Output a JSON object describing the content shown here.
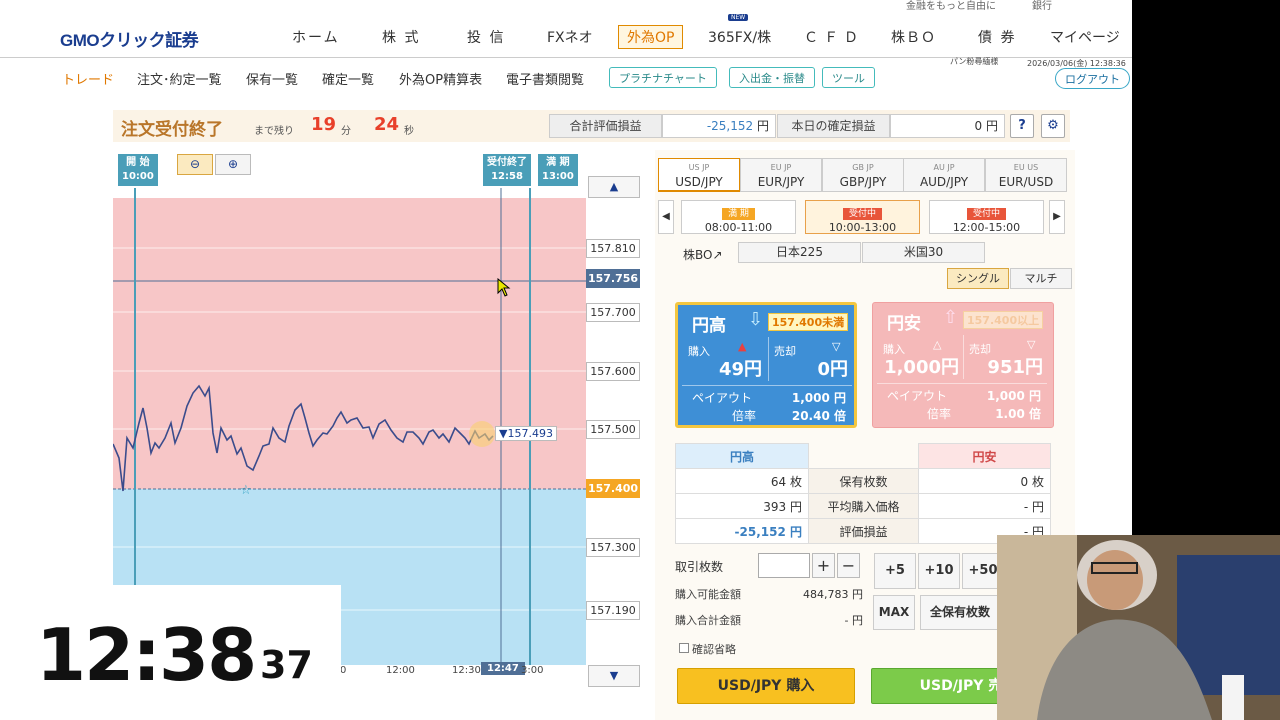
{
  "topstrip": {
    "text1": "金融をもっと自由に",
    "text2": "銀行"
  },
  "nav": {
    "logo": "GMOクリック証券",
    "items": [
      "ホーム",
      "株 式",
      "投 信",
      "FXネオ",
      "外為OP",
      "365FX/株",
      "ＣＦＤ",
      "株ＢＯ",
      "債 券",
      "マイページ"
    ],
    "new_badge": "NEW"
  },
  "subnav": {
    "items": [
      "トレード",
      "注文･約定一覧",
      "保有一覧",
      "確定一覧",
      "外為OP精算表",
      "電子書類閲覧"
    ],
    "pills": [
      "プラチナチャート",
      "入出金・振替",
      "ツール"
    ],
    "user": "パン粉尋緬様",
    "datetime": "2026/03/06(金) 12:38:36",
    "logout": "ログアウト"
  },
  "status": {
    "title": "注文受付終了",
    "remain_label": "まで残り",
    "minutes": "19",
    "min_unit": "分",
    "seconds": "24",
    "sec_unit": "秒",
    "total_label": "合計評価損益",
    "total_value": "-25,152",
    "yen": "円",
    "today_label": "本日の確定損益",
    "today_value": "0"
  },
  "chart": {
    "start_label": "開 始",
    "start_time": "10:00",
    "close_label": "受付終了",
    "close_time": "12:58",
    "expiry_label": "満 期",
    "expiry_time": "13:00",
    "price_ticks": [
      "157.810",
      "157.700",
      "157.600",
      "157.500",
      "157.300",
      "157.190"
    ],
    "current_line_price": "157.756",
    "strike": "157.400",
    "last_price": "▼157.493",
    "x_labels": [
      "0",
      "12:00",
      "12:30",
      "3:00"
    ],
    "now_label": "12:47"
  },
  "clock": {
    "hm": "12:38",
    "sec": "37"
  },
  "panel": {
    "pairs": [
      {
        "label": "USD/JPY",
        "flags": "US JP"
      },
      {
        "label": "EUR/JPY",
        "flags": "EU JP"
      },
      {
        "label": "GBP/JPY",
        "flags": "GB JP"
      },
      {
        "label": "AUD/JPY",
        "flags": "AU JP"
      },
      {
        "label": "EUR/USD",
        "flags": "EU US"
      }
    ],
    "slots": [
      {
        "badge": "満 期",
        "time": "08:00-11:00",
        "color": "#f5a623"
      },
      {
        "badge": "受付中",
        "time": "10:00-13:00",
        "color": "#e8553a"
      },
      {
        "badge": "受付中",
        "time": "12:00-15:00",
        "color": "#e8553a"
      }
    ],
    "kabubo": "株BO↗",
    "kabu_items": [
      "日本225",
      "米国30"
    ],
    "modes": [
      "シングル",
      "マルチ"
    ],
    "cards": {
      "high": {
        "title": "円高",
        "threshold": "157.400未満",
        "buy_label": "購入",
        "buy_price": "49円",
        "sell_label": "売却",
        "sell_price": "0円",
        "payout_label": "ペイアウト",
        "payout": "1,000 円",
        "rate_label": "倍率",
        "rate": "20.40 倍"
      },
      "low": {
        "title": "円安",
        "threshold": "157.400以上",
        "buy_label": "購入",
        "buy_price": "1,000円",
        "sell_label": "売却",
        "sell_price": "951円",
        "payout_label": "ペイアウト",
        "payout": "1,000 円",
        "rate_label": "倍率",
        "rate": "1.00 倍"
      }
    },
    "table": {
      "h_high": "円高",
      "h_low": "円安",
      "rows": [
        {
          "left": "64 枚",
          "mid": "保有枚数",
          "right": "0 枚"
        },
        {
          "left": "393 円",
          "mid": "平均購入価格",
          "right": "- 円"
        },
        {
          "left": "-25,152 円",
          "mid": "評価損益",
          "right": "- 円"
        }
      ]
    },
    "qty_label": "取引枚数",
    "inc": [
      "+5",
      "+10",
      "+50"
    ],
    "avail_label": "購入可能金額",
    "avail_value": "484,783 円",
    "total_buy_label": "購入合計金額",
    "total_buy_value": "- 円",
    "max_label": "MAX",
    "all_label": "全保有枚数",
    "skip_confirm": "確認省略",
    "buy_button": "USD/JPY 購入",
    "sell_button": "USD/JPY 売"
  }
}
